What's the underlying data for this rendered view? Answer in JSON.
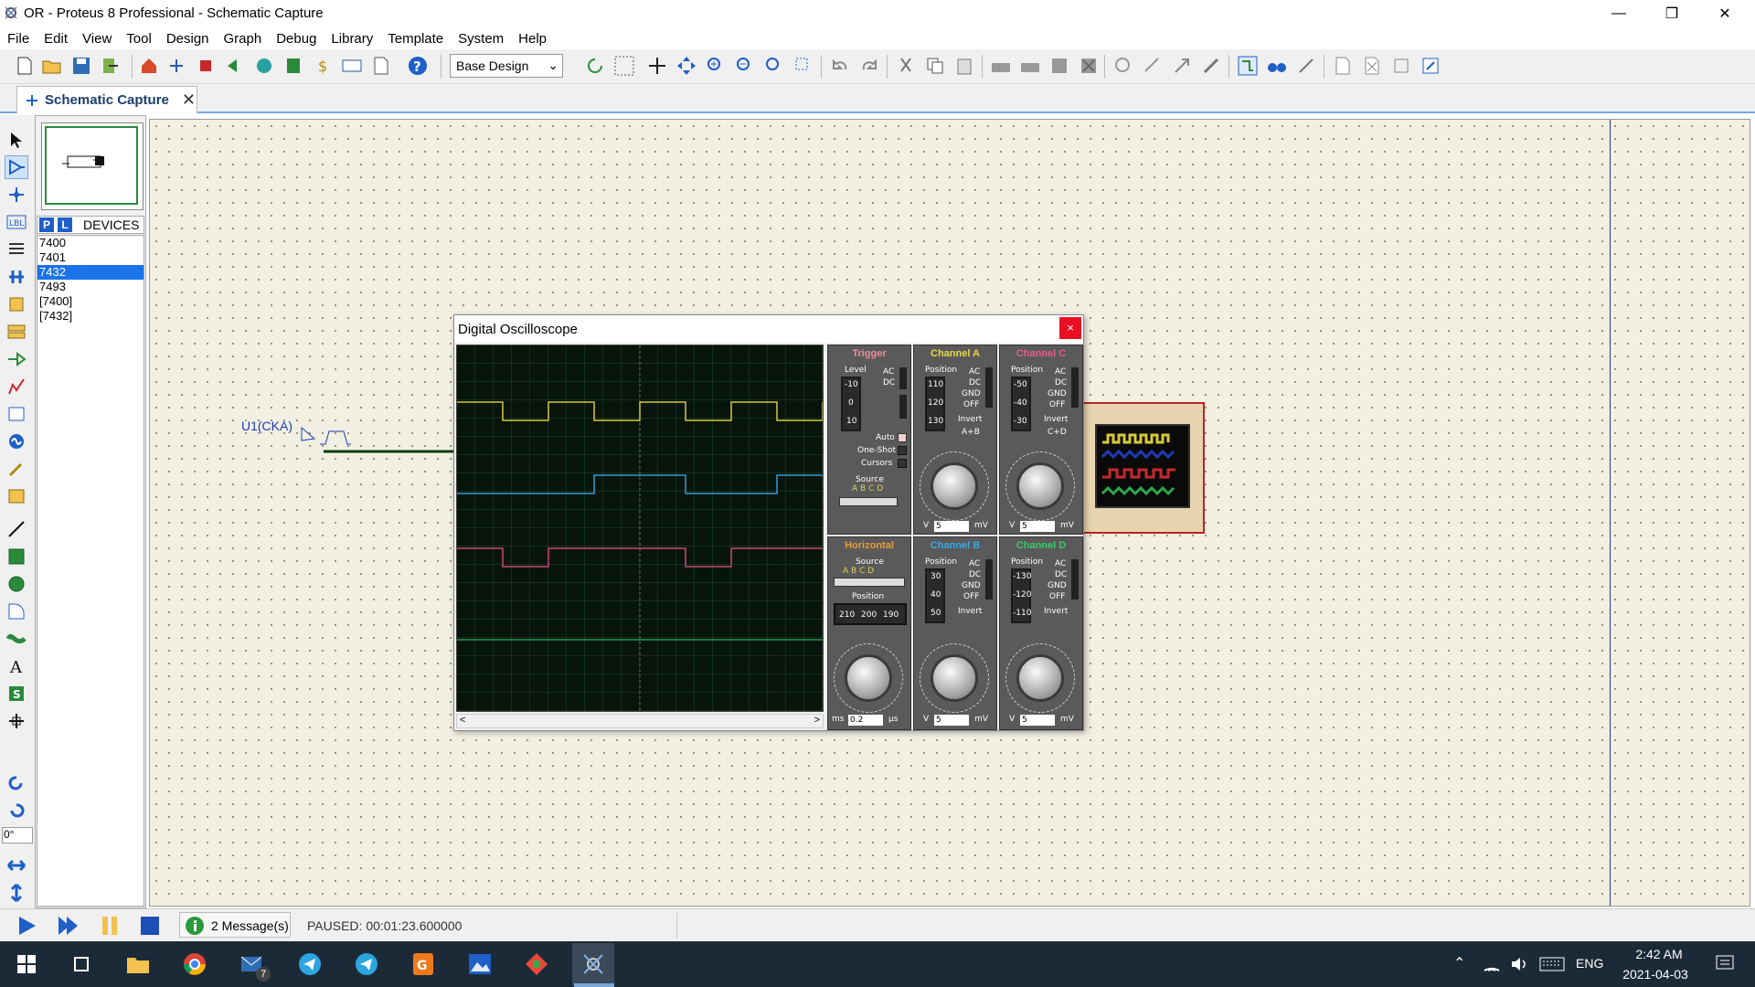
{
  "window": {
    "title": "OR - Proteus 8 Professional - Schematic Capture"
  },
  "menu": [
    "File",
    "Edit",
    "View",
    "Tool",
    "Design",
    "Graph",
    "Debug",
    "Library",
    "Template",
    "System",
    "Help"
  ],
  "toolbar": {
    "design_select": "Base Design"
  },
  "tabs": [
    {
      "label": "Schematic Capture"
    }
  ],
  "side_panel": {
    "p_button": "P",
    "l_button": "L",
    "devices_label": "DEVICES",
    "devices": [
      "7400",
      "7401",
      "7432",
      "7493",
      "[7400]",
      "[7432]"
    ],
    "selected": "7432"
  },
  "left_tools": {
    "rotation_value": "0°"
  },
  "schematic": {
    "source_label": "U1(CKA)"
  },
  "oscilloscope": {
    "title": "Digital Oscilloscope",
    "close": "×",
    "trigger": {
      "header": "Trigger",
      "level": "Level",
      "ac": "AC",
      "dc": "DC",
      "auto": "Auto",
      "one_shot": "One-Shot",
      "cursors": "Cursors",
      "source": "Source",
      "source_letters": "A B C D",
      "level_ticks": [
        "-10",
        "0",
        "10"
      ]
    },
    "horizontal": {
      "header": "Horizontal",
      "source": "Source",
      "source_letters": "A B C D",
      "position": "Position",
      "position_ticks": [
        "210",
        "200",
        "190"
      ],
      "value": "0.2",
      "unit_left": "ms",
      "unit_right": "µs"
    },
    "channel_a": {
      "header": "Channel A",
      "position": "Position",
      "ticks": [
        "110",
        "120",
        "130"
      ],
      "ac": "AC",
      "dc": "DC",
      "gnd": "GND",
      "off": "OFF",
      "invert": "Invert",
      "combine": "A+B",
      "value": "5",
      "unit_left": "V",
      "unit_right": "mV"
    },
    "channel_b": {
      "header": "Channel B",
      "position": "Position",
      "ticks": [
        "30",
        "40",
        "50"
      ],
      "ac": "AC",
      "dc": "DC",
      "gnd": "GND",
      "off": "OFF",
      "invert": "Invert",
      "value": "5",
      "unit_left": "V",
      "unit_right": "mV"
    },
    "channel_c": {
      "header": "Channel C",
      "position": "Position",
      "ticks": [
        "-50",
        "-40",
        "-30"
      ],
      "ac": "AC",
      "dc": "DC",
      "gnd": "GND",
      "off": "OFF",
      "invert": "Invert",
      "combine": "C+D",
      "value": "5",
      "unit_left": "V",
      "unit_right": "mV"
    },
    "channel_d": {
      "header": "Channel D",
      "position": "Position",
      "ticks": [
        "-130",
        "-120",
        "-110"
      ],
      "ac": "AC",
      "dc": "DC",
      "gnd": "GND",
      "off": "OFF",
      "invert": "Invert",
      "value": "5",
      "unit_left": "V",
      "unit_right": "mV"
    }
  },
  "status": {
    "messages": "2 Message(s)",
    "state": "PAUSED: 00:01:23.600000"
  },
  "taskbar": {
    "lang": "ENG",
    "time": "2:42 AM",
    "date": "2021-04-03",
    "mail_badge": "7"
  },
  "colors": {
    "trace_a": "#d8c83a",
    "trace_b": "#2a9fd8",
    "trace_c": "#c8487a",
    "trace_d": "#2a9a52",
    "selection": "#1a73e8"
  }
}
